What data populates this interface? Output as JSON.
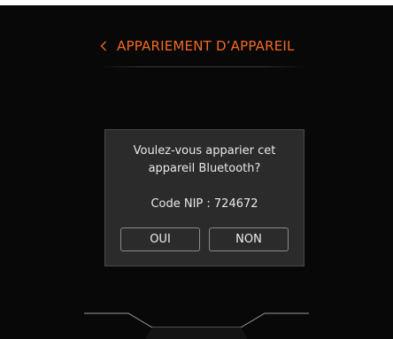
{
  "header": {
    "back_icon": "chevron-left-icon",
    "title": "APPARIEMENT D’APPAREIL"
  },
  "dialog": {
    "message_line1": "Voulez-vous apparier cet",
    "message_line2": "appareil Bluetooth?",
    "pin_label": "Code NIP",
    "pin_separator": " : ",
    "pin_value": "724672",
    "yes_label": "OUI",
    "no_label": "NON"
  },
  "colors": {
    "accent": "#f26a21",
    "background": "#080808",
    "dialog_bg": "#2b2b2b",
    "dialog_border": "#4a4a4a",
    "text": "#e8e8e8"
  }
}
